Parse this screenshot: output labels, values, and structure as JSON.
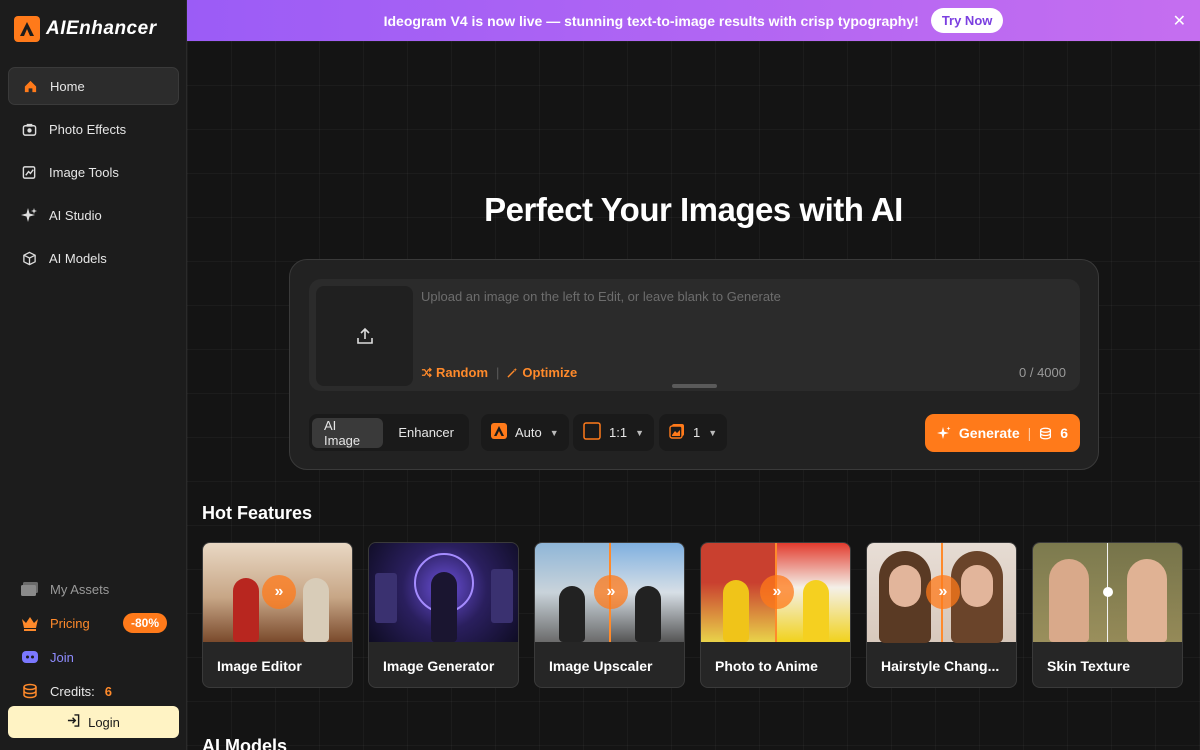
{
  "brand": {
    "name": "AIEnhancer",
    "accent": "#ff7a1a"
  },
  "sidebar": {
    "items": [
      {
        "label": "Home",
        "icon": "home-icon",
        "active": true
      },
      {
        "label": "Photo Effects",
        "icon": "camera-icon"
      },
      {
        "label": "Image Tools",
        "icon": "image-edit-icon"
      },
      {
        "label": "AI Studio",
        "icon": "sparkle-icon"
      },
      {
        "label": "AI Models",
        "icon": "cube-icon"
      }
    ],
    "my_assets": "My Assets",
    "pricing": "Pricing",
    "pricing_badge": "-80%",
    "join": "Join",
    "credits_label": "Credits:",
    "credits_value": "6",
    "login": "Login"
  },
  "banner": {
    "text": "Ideogram V4 is now live — stunning text-to-image results with crisp typography!",
    "cta": "Try Now",
    "close": "✕"
  },
  "hero": {
    "title": "Perfect Your Images with AI"
  },
  "prompt": {
    "placeholder": "Upload an image on the left to Edit, or leave blank to Generate",
    "random": "Random",
    "optimize": "Optimize",
    "counter": "0 / 4000"
  },
  "controls": {
    "modes": [
      "AI Image",
      "Enhancer"
    ],
    "model": "Auto",
    "ratio": "1:1",
    "count": "1",
    "generate": "Generate",
    "generate_cost": "6"
  },
  "hot_features": {
    "title": "Hot Features",
    "cards": [
      {
        "label": "Image Editor"
      },
      {
        "label": "Image Generator"
      },
      {
        "label": "Image Upscaler"
      },
      {
        "label": "Photo to Anime"
      },
      {
        "label": "Hairstyle Chang..."
      },
      {
        "label": "Skin Texture"
      }
    ]
  },
  "ai_models": {
    "title": "AI Models"
  }
}
